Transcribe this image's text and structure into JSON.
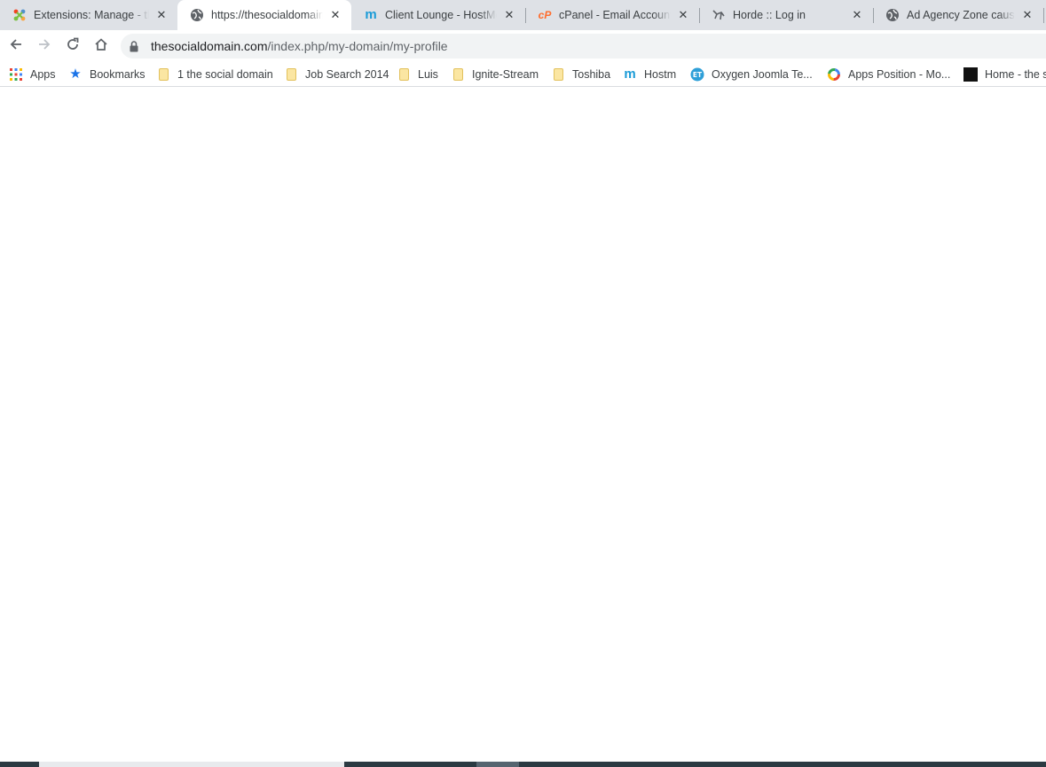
{
  "tabs": [
    {
      "title": "Extensions: Manage - the social domain",
      "icon": "joomla-icon",
      "active": false
    },
    {
      "title": "https://thesocialdomain.com/index.php/my-domain/my-profile",
      "icon": "globe-icon",
      "active": true
    },
    {
      "title": "Client Lounge - HostMonster",
      "icon": "hostmonster-icon",
      "active": false
    },
    {
      "title": "cPanel - Email Accounts",
      "icon": "cpanel-icon",
      "active": false
    },
    {
      "title": "Horde :: Log in",
      "icon": "horde-icon",
      "active": false
    },
    {
      "title": "Ad Agency Zone cause blank page",
      "icon": "globe-icon",
      "active": false
    }
  ],
  "toolbar": {
    "back_icon": "back-arrow-icon",
    "forward_icon": "forward-arrow-icon",
    "reload_icon": "reload-icon",
    "home_icon": "home-icon"
  },
  "address": {
    "domain": "thesocialdomain.com",
    "path": "/index.php/my-domain/my-profile"
  },
  "bookmarks": [
    {
      "label": "Apps",
      "icon": "apps-grid-icon"
    },
    {
      "label": "Bookmarks",
      "icon": "star-icon"
    },
    {
      "label": "1 the social domain",
      "icon": "folder-icon"
    },
    {
      "label": "Job Search 2014",
      "icon": "folder-icon"
    },
    {
      "label": "Luis",
      "icon": "folder-icon"
    },
    {
      "label": "Ignite-Stream",
      "icon": "folder-icon"
    },
    {
      "label": "Toshiba",
      "icon": "folder-icon"
    },
    {
      "label": "Hostm",
      "icon": "hostmonster-icon"
    },
    {
      "label": "Oxygen Joomla Te...",
      "icon": "et-icon"
    },
    {
      "label": "Apps Position - Mo...",
      "icon": "ring-icon"
    },
    {
      "label": "Home - the s",
      "icon": "tsd-icon"
    }
  ],
  "colors": {
    "tabstrip": "#dee1e6",
    "omnibox": "#f1f3f4",
    "hostmonster": "#1a9bd7",
    "cpanel": "#ff6c2c",
    "star": "#1a73e8"
  }
}
